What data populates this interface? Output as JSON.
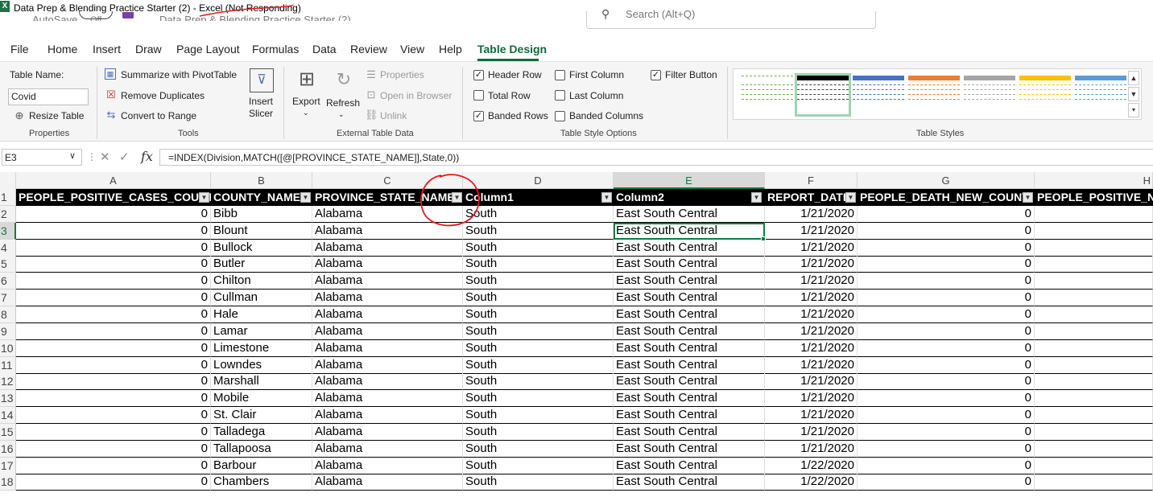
{
  "titlebar": {
    "title": "Data Prep & Blending Practice Starter (2) - Excel (Not Responding)",
    "autosave_label": "AutoSave",
    "autosave_state": "Off",
    "doc_name": "Data Prep & Blending Practice Starter (2)",
    "search_placeholder": "Search (Alt+Q)"
  },
  "menu": {
    "tabs": [
      "File",
      "Home",
      "Insert",
      "Draw",
      "Page Layout",
      "Formulas",
      "Data",
      "Review",
      "View",
      "Help",
      "Table Design"
    ],
    "active": "Table Design"
  },
  "ribbon": {
    "properties": {
      "table_name_label": "Table Name:",
      "table_name_value": "Covid",
      "resize_label": "Resize Table",
      "group": "Properties"
    },
    "tools": {
      "summarize": "Summarize with PivotTable",
      "remove_dup": "Remove Duplicates",
      "convert": "Convert to Range",
      "insert_slicer_1": "Insert",
      "insert_slicer_2": "Slicer",
      "group": "Tools"
    },
    "external": {
      "export": "Export",
      "refresh": "Refresh",
      "properties": "Properties",
      "open_browser": "Open in Browser",
      "unlink": "Unlink",
      "group": "External Table Data"
    },
    "style_options": {
      "header_row": "Header Row",
      "total_row": "Total Row",
      "banded_rows": "Banded Rows",
      "first_column": "First Column",
      "last_column": "Last Column",
      "banded_columns": "Banded Columns",
      "filter_button": "Filter Button",
      "checked": {
        "header_row": true,
        "total_row": false,
        "banded_rows": true,
        "first_column": false,
        "last_column": false,
        "banded_columns": false,
        "filter_button": true
      },
      "group": "Table Style Options"
    },
    "styles": {
      "group": "Table Styles",
      "swatches": [
        "#70ad47",
        "#000000",
        "#4472c4",
        "#ed7d31",
        "#a5a5a5",
        "#ffc000",
        "#5b9bd5"
      ],
      "selected_index": 1
    }
  },
  "formula_bar": {
    "name_box": "E3",
    "formula": "=INDEX(Division,MATCH([@[PROVINCE_STATE_NAME]],State,0))"
  },
  "grid": {
    "col_letters": [
      "A",
      "B",
      "C",
      "D",
      "E",
      "F",
      "G",
      "H"
    ],
    "selected_col": "E",
    "selected_row": "3",
    "row_numbers": [
      "1",
      "2",
      "3",
      "4",
      "5",
      "6",
      "7",
      "8",
      "9",
      "10",
      "11",
      "12",
      "13",
      "14",
      "15",
      "16",
      "17",
      "18"
    ],
    "headers": [
      "PEOPLE_POSITIVE_CASES_COUNT",
      "COUNTY_NAME",
      "PROVINCE_STATE_NAME",
      "Column1",
      "Column2",
      "REPORT_DATE",
      "PEOPLE_DEATH_NEW_COUNT",
      "PEOPLE_POSITIVE_NE"
    ],
    "rows": [
      [
        "0",
        "Bibb",
        "Alabama",
        "South",
        "East South Central",
        "1/21/2020",
        "0"
      ],
      [
        "0",
        "Blount",
        "Alabama",
        "South",
        "East South Central",
        "1/21/2020",
        "0"
      ],
      [
        "0",
        "Bullock",
        "Alabama",
        "South",
        "East South Central",
        "1/21/2020",
        "0"
      ],
      [
        "0",
        "Butler",
        "Alabama",
        "South",
        "East South Central",
        "1/21/2020",
        "0"
      ],
      [
        "0",
        "Chilton",
        "Alabama",
        "South",
        "East South Central",
        "1/21/2020",
        "0"
      ],
      [
        "0",
        "Cullman",
        "Alabama",
        "South",
        "East South Central",
        "1/21/2020",
        "0"
      ],
      [
        "0",
        "Hale",
        "Alabama",
        "South",
        "East South Central",
        "1/21/2020",
        "0"
      ],
      [
        "0",
        "Lamar",
        "Alabama",
        "South",
        "East South Central",
        "1/21/2020",
        "0"
      ],
      [
        "0",
        "Limestone",
        "Alabama",
        "South",
        "East South Central",
        "1/21/2020",
        "0"
      ],
      [
        "0",
        "Lowndes",
        "Alabama",
        "South",
        "East South Central",
        "1/21/2020",
        "0"
      ],
      [
        "0",
        "Marshall",
        "Alabama",
        "South",
        "East South Central",
        "1/21/2020",
        "0"
      ],
      [
        "0",
        "Mobile",
        "Alabama",
        "South",
        "East South Central",
        "1/21/2020",
        "0"
      ],
      [
        "0",
        "St. Clair",
        "Alabama",
        "South",
        "East South Central",
        "1/21/2020",
        "0"
      ],
      [
        "0",
        "Talladega",
        "Alabama",
        "South",
        "East South Central",
        "1/21/2020",
        "0"
      ],
      [
        "0",
        "Tallapoosa",
        "Alabama",
        "South",
        "East South Central",
        "1/21/2020",
        "0"
      ],
      [
        "0",
        "Barbour",
        "Alabama",
        "South",
        "East South Central",
        "1/22/2020",
        "0"
      ],
      [
        "0",
        "Chambers",
        "Alabama",
        "South",
        "East South Central",
        "1/22/2020",
        "0"
      ]
    ]
  },
  "colors": {
    "accent": "#107c41",
    "annotation": "#e21b1b"
  }
}
